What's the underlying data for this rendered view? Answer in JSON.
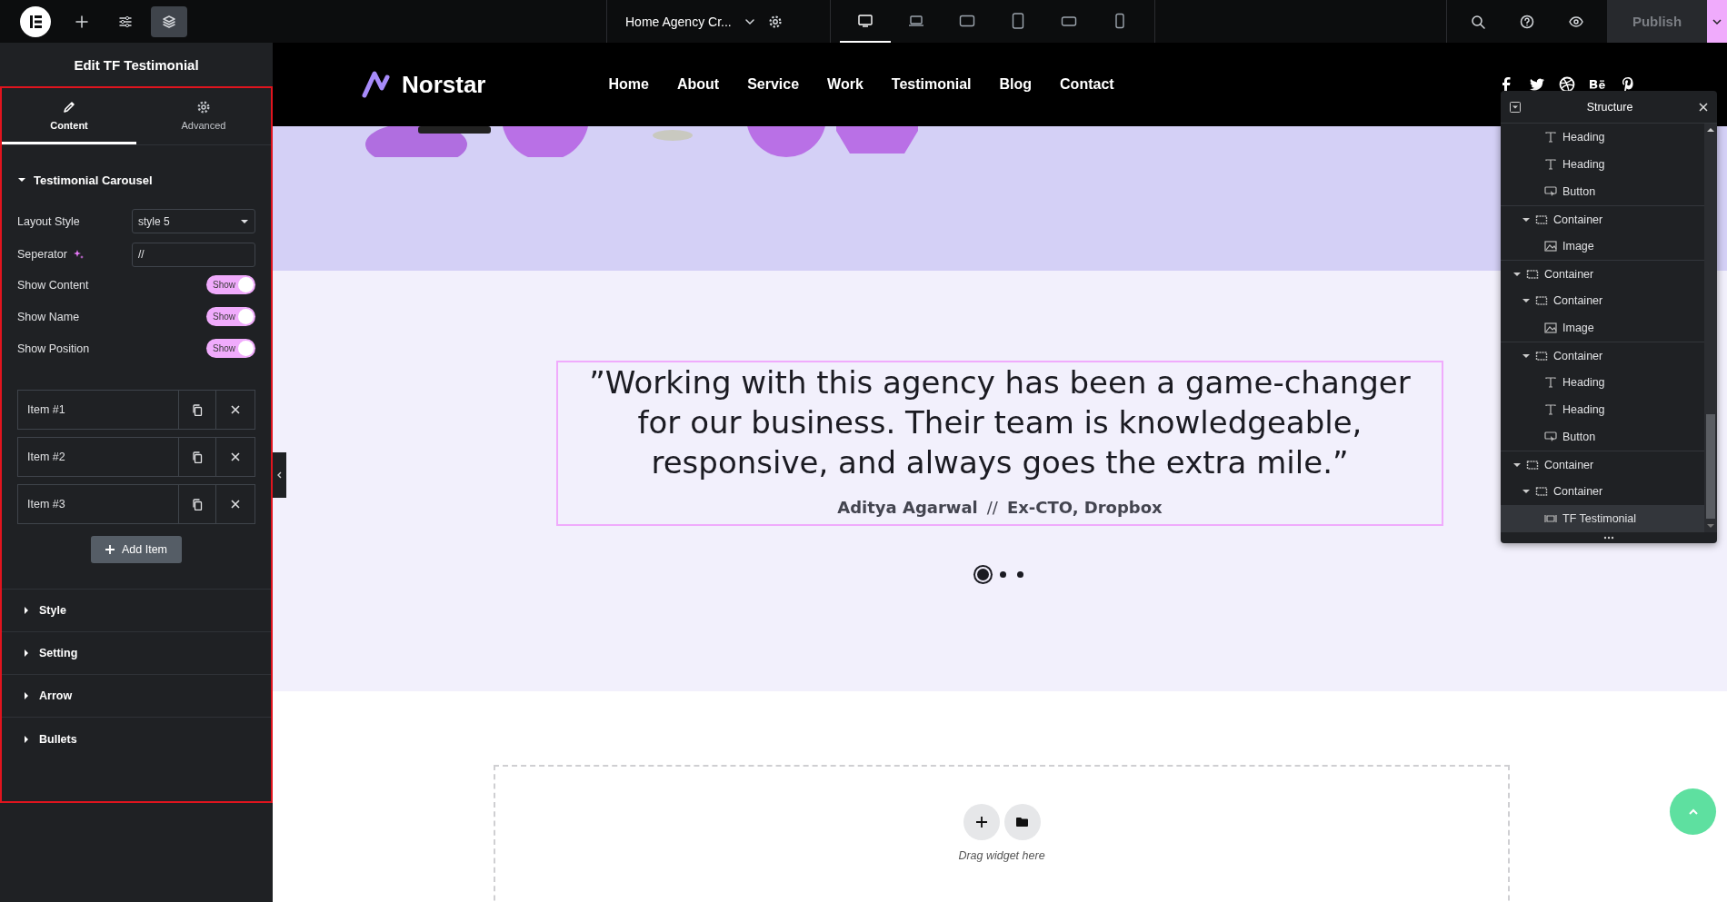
{
  "topbar": {
    "document_title": "Home Agency Cr...",
    "devices": [
      {
        "selected": true
      },
      {
        "selected": false
      },
      {
        "selected": false
      },
      {
        "selected": false
      },
      {
        "selected": false
      },
      {
        "selected": false
      }
    ],
    "publish": "Publish"
  },
  "panel": {
    "title": "Edit TF Testimonial",
    "tabs": [
      {
        "label": "Content",
        "selected": true
      },
      {
        "label": "Advanced",
        "selected": false
      }
    ],
    "section": {
      "title": "Testimonial Carousel",
      "expanded": true
    },
    "fields": [
      {
        "kind": "select",
        "label": "Layout Style",
        "value": "style 5"
      },
      {
        "kind": "text",
        "label": "Seperator",
        "value": "//"
      },
      {
        "kind": "toggle",
        "label": "Show Content",
        "on": true,
        "text": "Show"
      },
      {
        "kind": "toggle",
        "label": "Show Name",
        "on": true,
        "text": "Show"
      },
      {
        "kind": "toggle",
        "label": "Show Position",
        "on": true,
        "text": "Show"
      }
    ],
    "items": [
      {
        "label": "Item #1"
      },
      {
        "label": "Item #2"
      },
      {
        "label": "Item #3"
      }
    ],
    "add_button": "Add Item",
    "sections": [
      {
        "title": "Style",
        "expanded": false
      },
      {
        "title": "Setting",
        "expanded": false
      },
      {
        "title": "Arrow",
        "expanded": false
      },
      {
        "title": "Bullets",
        "expanded": false
      }
    ]
  },
  "site": {
    "logo": "Norstar",
    "nav": [
      "Home",
      "About",
      "Service",
      "Work",
      "Testimonial",
      "Blog",
      "Contact"
    ],
    "testimonial": {
      "quote": "”Working with this agency has been a game-changer for our business. Their team is knowledgeable, responsive, and always goes the extra mile.”",
      "name": "Aditya Agarwal",
      "separator": "//",
      "position": "Ex-CTO, Dropbox",
      "dots": [
        {
          "selected": true
        },
        {
          "selected": false
        },
        {
          "selected": false
        }
      ]
    },
    "dropzone": {
      "hint": "Drag widget here"
    }
  },
  "structure": {
    "title": "Structure",
    "tree": [
      {
        "children": [
          {
            "children": [
              {
                "kind": "heading",
                "label": "Heading",
                "selected": false
              },
              {
                "kind": "heading",
                "label": "Heading",
                "selected": false
              },
              {
                "kind": "button",
                "label": "Button",
                "selected": false
              }
            ]
          },
          {
            "kind": "container",
            "label": "Container",
            "expanded": true,
            "selected": false,
            "children": [
              {
                "kind": "image",
                "label": "Image",
                "selected": false
              }
            ]
          }
        ]
      },
      {
        "kind": "container",
        "label": "Container",
        "expanded": true,
        "selected": false,
        "children": [
          {
            "kind": "container",
            "label": "Container",
            "expanded": true,
            "selected": false,
            "children": [
              {
                "kind": "image",
                "label": "Image",
                "selected": false
              }
            ]
          },
          {
            "kind": "container",
            "label": "Container",
            "expanded": true,
            "selected": false,
            "children": [
              {
                "kind": "heading",
                "label": "Heading",
                "selected": false
              },
              {
                "kind": "heading",
                "label": "Heading",
                "selected": false
              },
              {
                "kind": "button",
                "label": "Button",
                "selected": false
              }
            ]
          }
        ]
      },
      {
        "kind": "container",
        "label": "Container",
        "expanded": true,
        "selected": false,
        "children": [
          {
            "kind": "container",
            "label": "Container",
            "expanded": true,
            "selected": false,
            "children": [
              {
                "kind": "widget",
                "label": "TF Testimonial",
                "selected": true
              }
            ]
          }
        ]
      }
    ]
  }
}
